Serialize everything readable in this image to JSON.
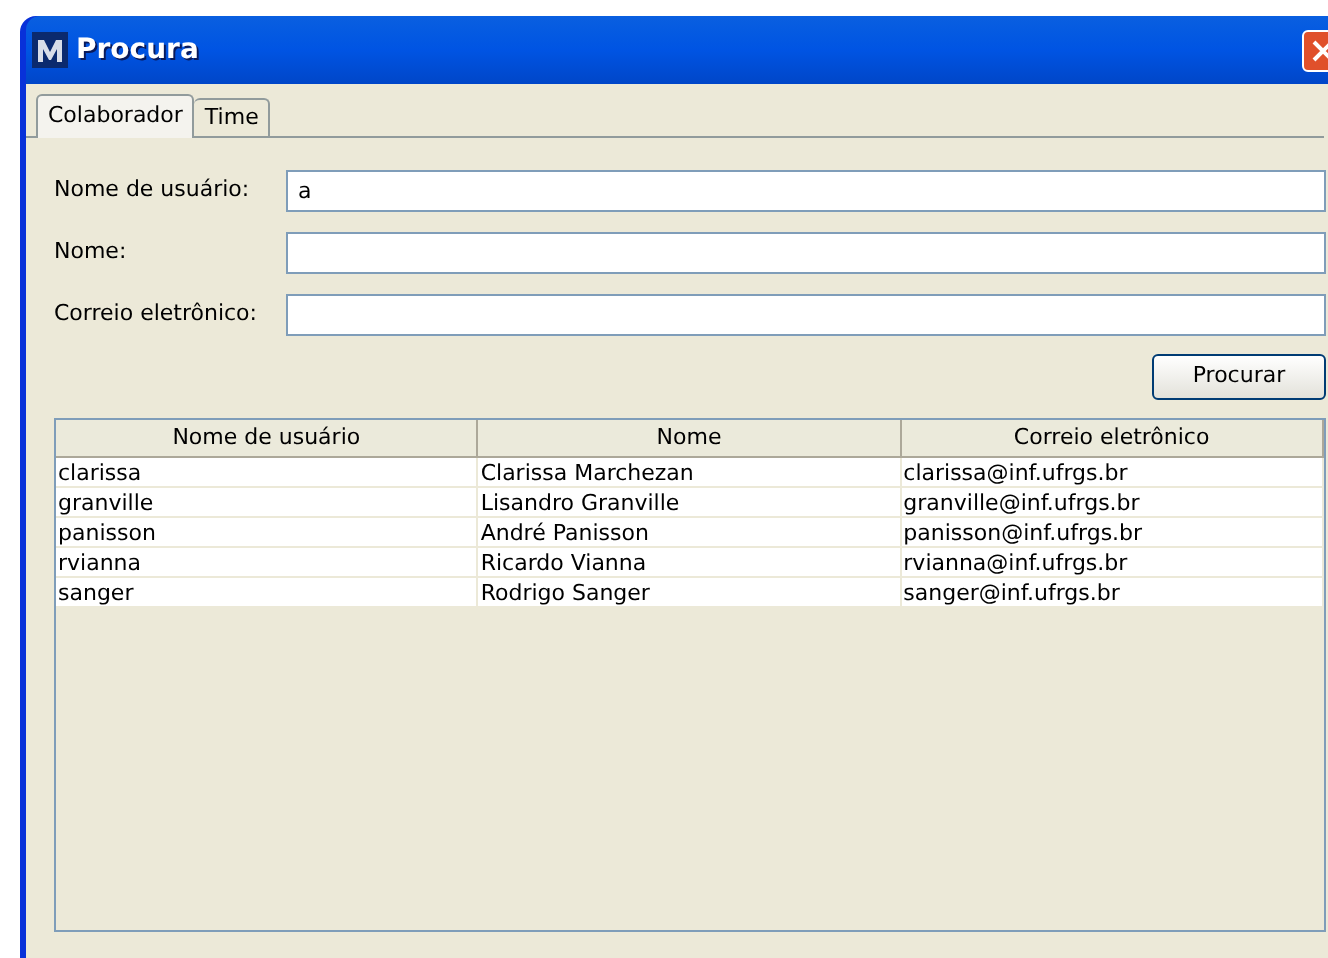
{
  "window": {
    "title": "Procura"
  },
  "tabs": [
    {
      "label": "Colaborador",
      "selected": true
    },
    {
      "label": "Time",
      "selected": false
    }
  ],
  "form": {
    "fields": [
      {
        "label": "Nome de usuário:",
        "value": "a"
      },
      {
        "label": "Nome:"
      },
      {
        "label": "Correio eletrônico:"
      }
    ],
    "search_button": "Procurar"
  },
  "table": {
    "columns": [
      "Nome de usuário",
      "Nome",
      "Correio eletrônico"
    ],
    "rows": [
      [
        "clarissa",
        "Clarissa Marchezan",
        "clarissa@inf.ufrgs.br"
      ],
      [
        "granville",
        "Lisandro Granville",
        "granville@inf.ufrgs.br"
      ],
      [
        "panisson",
        "André Panisson",
        "panisson@inf.ufrgs.br"
      ],
      [
        "rvianna",
        "Ricardo Vianna",
        "rvianna@inf.ufrgs.br"
      ],
      [
        "sanger",
        "Rodrigo Sanger",
        "sanger@inf.ufrgs.br"
      ]
    ]
  }
}
